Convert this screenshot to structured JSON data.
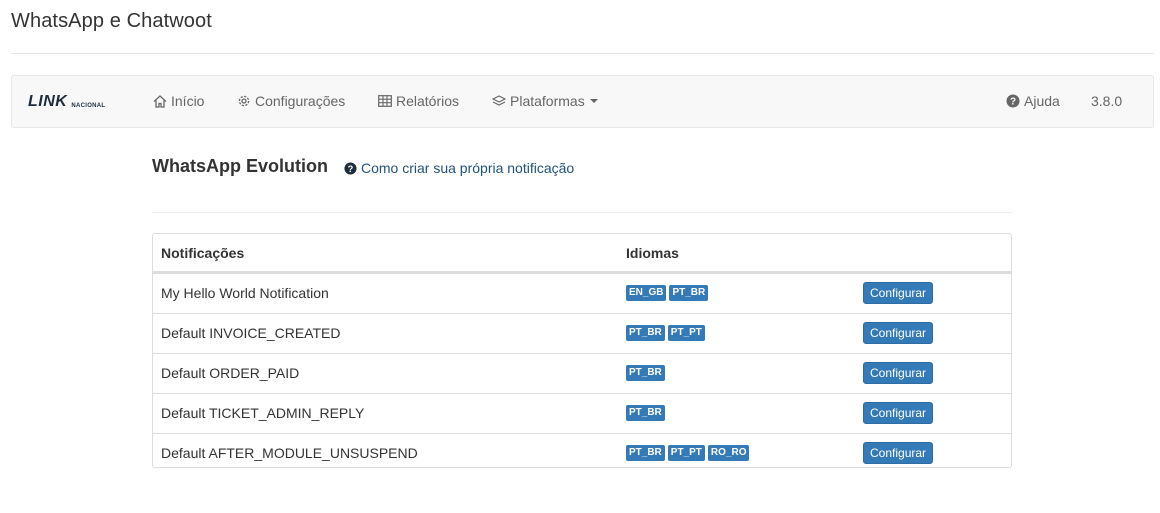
{
  "page": {
    "title": "WhatsApp e Chatwoot"
  },
  "navbar": {
    "logo_main": "LINK",
    "logo_sub": "NACIONAL",
    "items": [
      {
        "label": "Início",
        "icon": "home-icon"
      },
      {
        "label": "Configurações",
        "icon": "gear-icon"
      },
      {
        "label": "Relatórios",
        "icon": "table-icon"
      },
      {
        "label": "Plataformas",
        "icon": "layers-icon",
        "dropdown": true
      }
    ],
    "help_label": "Ajuda",
    "version": "3.8.0"
  },
  "section": {
    "title": "WhatsApp Evolution",
    "howto_link": "Como criar sua própria notificação"
  },
  "table": {
    "headers": [
      "Notificações",
      "Idiomas",
      ""
    ],
    "rows": [
      {
        "name": "My Hello World Notification",
        "langs": [
          "EN_GB",
          "PT_BR"
        ],
        "action": "Configurar"
      },
      {
        "name": "Default INVOICE_CREATED",
        "langs": [
          "PT_BR",
          "PT_PT"
        ],
        "action": "Configurar"
      },
      {
        "name": "Default ORDER_PAID",
        "langs": [
          "PT_BR"
        ],
        "action": "Configurar"
      },
      {
        "name": "Default TICKET_ADMIN_REPLY",
        "langs": [
          "PT_BR"
        ],
        "action": "Configurar"
      },
      {
        "name": "Default AFTER_MODULE_UNSUSPEND",
        "langs": [
          "PT_BR",
          "PT_PT",
          "RO_RO"
        ],
        "action": "Configurar"
      }
    ]
  },
  "colors": {
    "primary": "#337ab7",
    "navbar_bg": "#f8f8f8",
    "link": "#23527c"
  }
}
